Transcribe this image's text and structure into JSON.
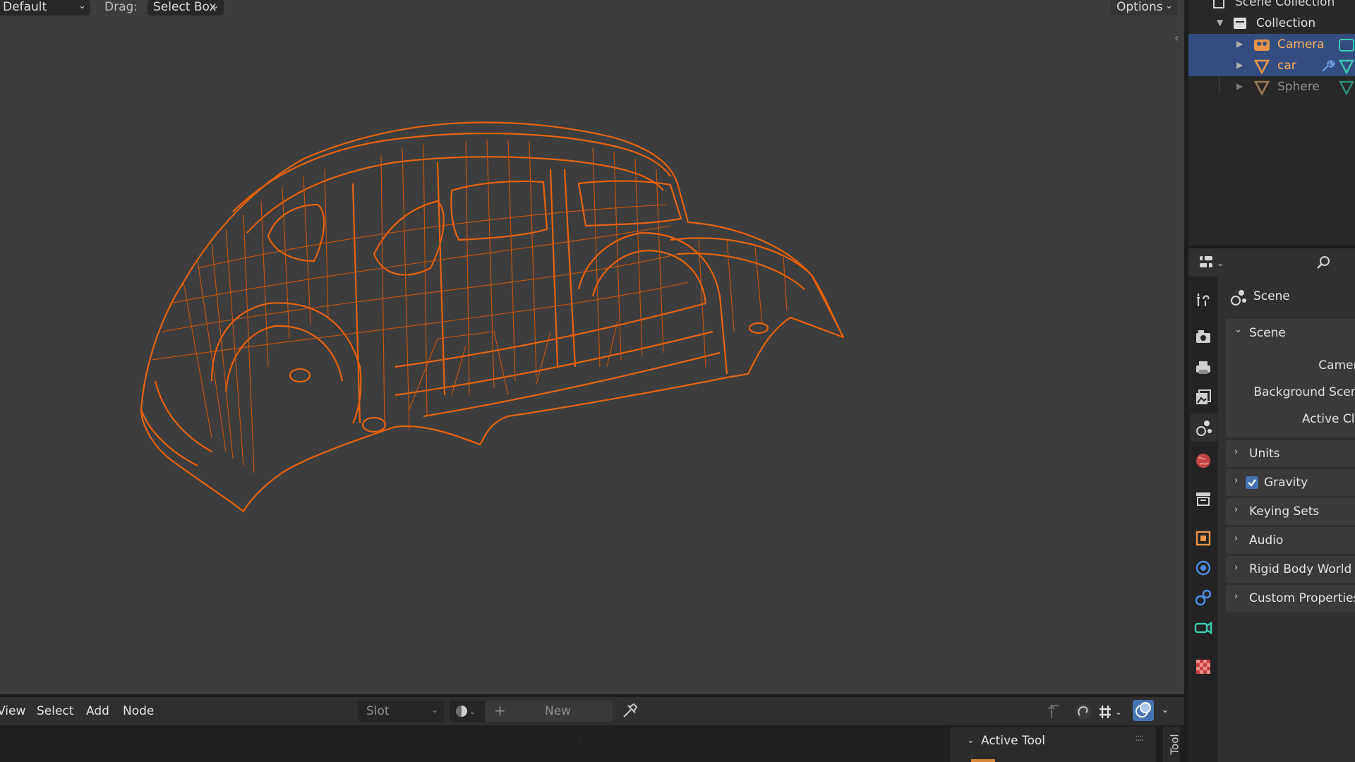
{
  "viewport": {
    "header": {
      "orientation_value": "Default",
      "drag_label": "Drag:",
      "drag_value": "Select Box",
      "options_label": "Options"
    },
    "object_color": "#e8620e",
    "background_color": "#3d3d3d"
  },
  "node_editor": {
    "menu": [
      "View",
      "Select",
      "Add",
      "Node"
    ],
    "slot_label": "Slot",
    "new_label": "New",
    "active_tool_title": "Active Tool",
    "tool_tab_label": "Tool",
    "accent_color": "#4772b3"
  },
  "outliner": {
    "scene_collection": "Scene Collection",
    "collection": "Collection",
    "items": [
      {
        "name": "Camera",
        "selected": true,
        "icon": "camera-object-icon"
      },
      {
        "name": "car",
        "selected": true,
        "icon": "mesh-object-icon"
      },
      {
        "name": "Sphere",
        "selected": false,
        "icon": "mesh-object-icon"
      }
    ]
  },
  "properties": {
    "context_title": "Scene",
    "scene_panel": {
      "title": "Scene",
      "fields": [
        "Camera",
        "Background Scene",
        "Active Clip"
      ]
    },
    "panels": [
      {
        "label": "Units",
        "checkbox": false
      },
      {
        "label": "Gravity",
        "checkbox": true,
        "checked": true
      },
      {
        "label": "Keying Sets",
        "checkbox": false
      },
      {
        "label": "Audio",
        "checkbox": false
      },
      {
        "label": "Rigid Body World",
        "checkbox": false
      },
      {
        "label": "Custom Properties",
        "checkbox": false
      }
    ],
    "tabs": [
      "tool-icon",
      "render-icon",
      "output-icon",
      "view-layer-icon",
      "scene-icon",
      "world-icon",
      "collection-icon",
      "object-icon",
      "modifier-icon",
      "constraint-icon",
      "data-icon",
      "texture-icon"
    ]
  }
}
